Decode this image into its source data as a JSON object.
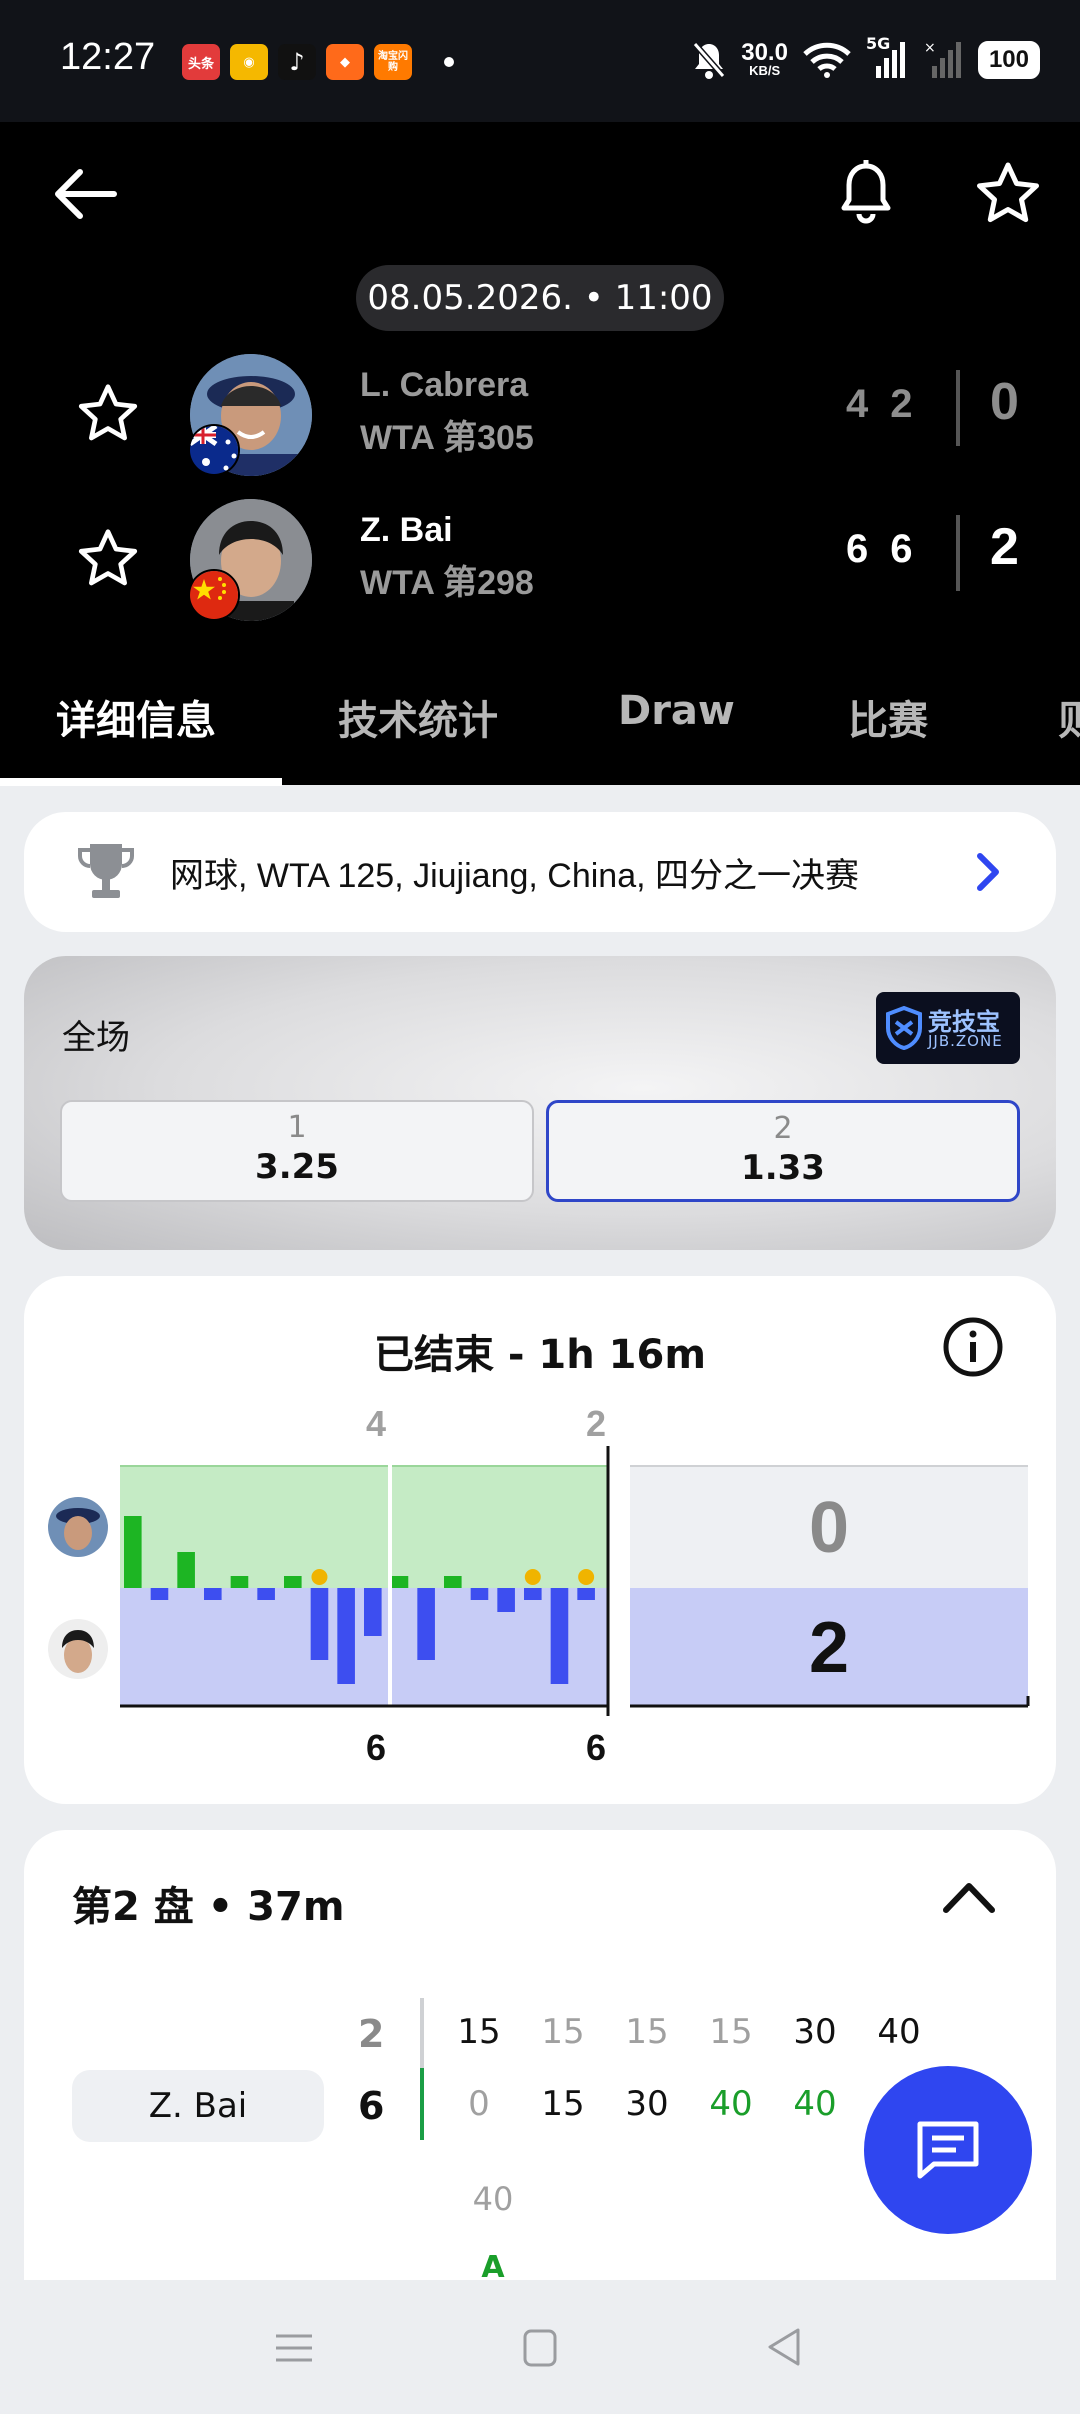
{
  "status_bar": {
    "time": "12:27",
    "apps": [
      "头条",
      "微博",
      "抖音",
      "小红",
      "淘宝闪购"
    ],
    "net_speed": "30.0",
    "net_unit": "KB/S",
    "network": "5G",
    "battery": "100"
  },
  "match": {
    "datetime": "08.05.2026. • 11:00",
    "players": [
      {
        "name": "L. Cabrera",
        "rank": "WTA 第305",
        "sets": [
          "4",
          "2"
        ],
        "total": "0",
        "flag": "australia"
      },
      {
        "name": "Z. Bai",
        "rank": "WTA 第298",
        "sets": [
          "6",
          "6"
        ],
        "total": "2",
        "flag": "china"
      }
    ]
  },
  "tabs": [
    "详细信息",
    "技术统计",
    "Draw",
    "比赛",
    "则"
  ],
  "tournament": {
    "text": "网球, WTA 125, Jiujiang, China, 四分之一决赛"
  },
  "odds": {
    "label": "全场",
    "brand_main": "竞技宝",
    "brand_sub": "JJB.ZONE",
    "options": [
      {
        "index": "1",
        "value": "3.25"
      },
      {
        "index": "2",
        "value": "1.33"
      }
    ]
  },
  "chart_data": {
    "type": "bar",
    "title": "已结束 - 1h 16m",
    "sets": [
      {
        "top_score": "4",
        "bottom_score": "6"
      },
      {
        "top_score": "2",
        "bottom_score": "6"
      }
    ],
    "total": {
      "top": "0",
      "bottom": "2"
    },
    "series": [
      {
        "name": "L. Cabrera",
        "values": [
          3,
          0,
          1.5,
          0,
          0.5,
          0,
          0.5,
          0,
          0,
          0,
          0.5,
          0,
          0.5,
          0,
          0,
          0,
          0
        ]
      },
      {
        "name": "Z. Bai",
        "values": [
          0,
          0.5,
          0,
          0.5,
          0,
          0.5,
          0,
          3,
          4,
          2,
          0,
          3,
          0,
          0.5,
          1,
          0.5,
          4,
          0.5
        ]
      }
    ],
    "break_markers": [
      8,
      16,
      18
    ]
  },
  "set_detail": {
    "title": "第2 盘 • 37m",
    "player": "Z. Bai",
    "row1": {
      "set": "2",
      "points": [
        "15",
        "15",
        "15",
        "15",
        "30",
        "40"
      ]
    },
    "row2": {
      "set": "6",
      "points": [
        "0",
        "15",
        "30",
        "40",
        "40",
        "A"
      ]
    },
    "extra_top": "40",
    "extra_bottom": "A"
  },
  "colors": {
    "accent": "#2f46f0",
    "green": "#1a9e2a",
    "blue_bar": "#3d4ef0",
    "green_bar": "#1db523"
  }
}
